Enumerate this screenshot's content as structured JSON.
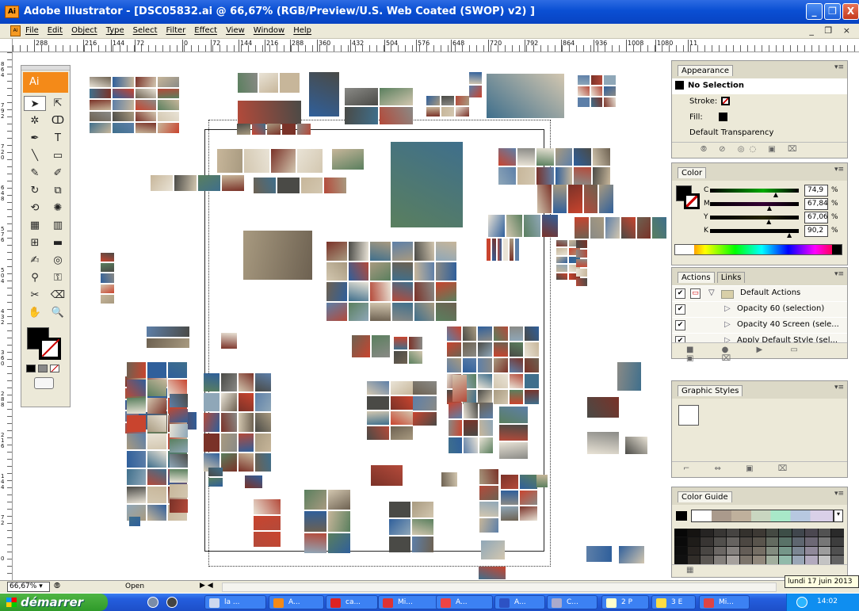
{
  "window": {
    "title": "Adobe Illustrator - [DSC05832.ai @ 66,67% (RGB/Preview/U.S. Web Coated (SWOP) v2) ]",
    "app_icon": "Ai",
    "controls": [
      "_",
      "❐",
      "X"
    ]
  },
  "menubar": {
    "doc_icon": "Ai",
    "items": [
      "File",
      "Edit",
      "Object",
      "Type",
      "Select",
      "Filter",
      "Effect",
      "View",
      "Window",
      "Help"
    ],
    "doc_controls": "_ ❐ ×"
  },
  "ruler": {
    "h_labels": [
      "288",
      "216",
      "144",
      "72",
      "0",
      "72",
      "144",
      "216",
      "288",
      "360",
      "432",
      "504",
      "576",
      "648",
      "720",
      "792",
      "864",
      "936",
      "1008",
      "1080",
      "11"
    ],
    "v_labels": [
      "864",
      "792",
      "720",
      "648",
      "576",
      "504",
      "432",
      "360",
      "288",
      "216",
      "144",
      "72",
      "0"
    ]
  },
  "toolbox": {
    "logo": "Ai",
    "tools": [
      "selection-icon",
      "direct-selection-icon",
      "magic-wand-icon",
      "lasso-icon",
      "pen-icon",
      "type-icon",
      "line-icon",
      "rectangle-icon",
      "paintbrush-icon",
      "pencil-icon",
      "rotate-icon",
      "scale-icon",
      "warp-icon",
      "symbol-sprayer-icon",
      "graph-icon",
      "column-graph-icon",
      "mesh-icon",
      "gradient-icon",
      "eyedropper-icon",
      "blend-icon",
      "live-paint-icon",
      "live-paint-select-icon",
      "scissors-icon",
      "eraser-icon",
      "hand-icon",
      "zoom-icon"
    ],
    "glyphs": [
      "➤",
      "⇱",
      "✲",
      "ↀ",
      "✒",
      "T",
      "╲",
      "▭",
      "✎",
      "✐",
      "↻",
      "⧉",
      "⟲",
      "✺",
      "▦",
      "▥",
      "⊞",
      "▬",
      "✍",
      "◎",
      "⚲",
      "⚿",
      "✂",
      "⌫",
      "✋",
      "🔍"
    ]
  },
  "appearance": {
    "tab": "Appearance",
    "selection": "No Selection",
    "stroke_label": "Stroke:",
    "fill_label": "Fill:",
    "transparency": "Default Transparency",
    "buttons": "⦾ ⊘ ◎◌ ▣ ⌧"
  },
  "color": {
    "tab": "Color",
    "channels": [
      {
        "name": "C",
        "value": "74,9",
        "pct": "%",
        "knob": 0.749
      },
      {
        "name": "M",
        "value": "67,84",
        "pct": "%",
        "knob": 0.678
      },
      {
        "name": "Y",
        "value": "67,06",
        "pct": "%",
        "knob": 0.671
      },
      {
        "name": "K",
        "value": "90,2",
        "pct": "%",
        "knob": 0.902
      }
    ]
  },
  "actions": {
    "tabs": [
      "Actions",
      "Links"
    ],
    "set": "Default Actions",
    "items": [
      "Opacity 60 (selection)",
      "Opacity 40 Screen (sele...",
      "Apply Default Style (sel..."
    ],
    "buttons": "■ ● ▶ ▭ ▣ ⌧"
  },
  "graphic_styles": {
    "tab": "Graphic Styles",
    "buttons": "⌐ ⇔ ▣ ⌧"
  },
  "color_guide": {
    "tab": "Color Guide",
    "buttons": "▦"
  },
  "statusbar": {
    "zoom": "66,67%",
    "status": "Open",
    "tooltip": "lundi 17 juin 2013"
  },
  "taskbar": {
    "start": "démarrer",
    "tasks": [
      "la ...",
      "A...",
      "ca...",
      "Mi...",
      "A...",
      "A...",
      "C...",
      "2 P",
      "3 E",
      "Mi..."
    ],
    "time": "14:02"
  },
  "colors": {
    "title_blue": "#0a4fd3",
    "panel_bg": "#ece9d8",
    "ai_orange": "#f48a18",
    "start_green": "#3aa435"
  }
}
